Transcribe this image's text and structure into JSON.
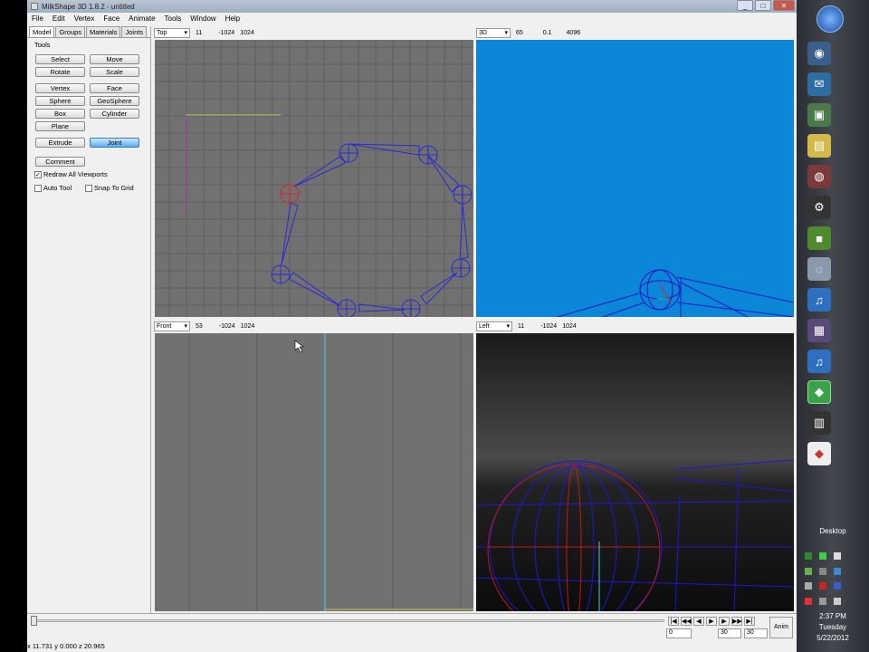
{
  "window": {
    "title": "MilkShape 3D 1.8.2 - untitled"
  },
  "menu": [
    "File",
    "Edit",
    "Vertex",
    "Face",
    "Animate",
    "Tools",
    "Window",
    "Help"
  ],
  "tabs": [
    "Model",
    "Groups",
    "Materials",
    "Joints"
  ],
  "tools_label": "Tools",
  "tools": {
    "select": "Select",
    "move": "Move",
    "rotate": "Rotate",
    "scale": "Scale",
    "vertex": "Vertex",
    "face": "Face",
    "sphere": "Sphere",
    "geosphere": "GeoSphere",
    "box": "Box",
    "cylinder": "Cylinder",
    "plane": "Plane",
    "extrude": "Extrude",
    "joint": "Joint",
    "comment": "Comment"
  },
  "options": {
    "redraw_all": "Redraw All Viewports",
    "redraw_all_checked": true,
    "auto_tool": "Auto Tool",
    "auto_tool_checked": false,
    "snap_to_grid": "Snap To Grid",
    "snap_to_grid_checked": false
  },
  "viewports": {
    "top": {
      "view": "Top",
      "v1": "11",
      "v2": "-1024",
      "v3": "1024"
    },
    "persp": {
      "view": "3D",
      "v1": "65",
      "v2": "0.1",
      "v3": "4096"
    },
    "front": {
      "view": "Front",
      "v1": "53",
      "v2": "-1024",
      "v3": "1024"
    },
    "left": {
      "view": "Left",
      "v1": "11",
      "v2": "-1024",
      "v3": "1024"
    }
  },
  "timeline": {
    "anim_label": "Anim",
    "frame_start": "0",
    "frame_current": "30",
    "frame_end": "30"
  },
  "status": "x 11.731 y 0.000 z 20.965",
  "tray": {
    "desktop_label": "Desktop",
    "time": "2:37 PM",
    "day": "Tuesday",
    "date": "5/22/2012"
  },
  "colors": {
    "persp_bg": "#0c86d6",
    "grid_bg": "#6e6e6e",
    "joint": "#2a2ad6",
    "selected": "#e0202a"
  }
}
